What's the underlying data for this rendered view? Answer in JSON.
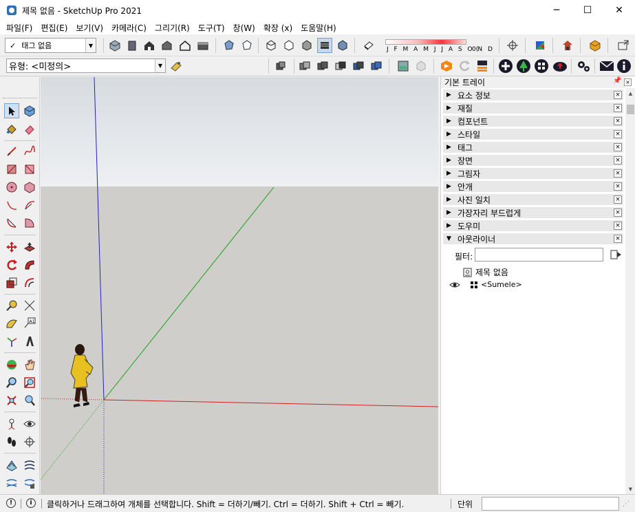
{
  "window": {
    "title": "제목 없음 - SketchUp Pro 2021",
    "minimize": "─",
    "maximize": "☐",
    "close": "✕"
  },
  "menu": [
    "파일(F)",
    "편집(E)",
    "보기(V)",
    "카메라(C)",
    "그리기(R)",
    "도구(T)",
    "창(W)",
    "확장 (x)",
    "도움말(H)"
  ],
  "toolbar": {
    "tag_check": "✓",
    "tag_value": "태그 없음",
    "type_value": "유형: <미정의>",
    "shadow_months": "J F M A M J J A S O N D",
    "shadow_right": "0("
  },
  "tray": {
    "title": "기본 트레이",
    "pin": "📌",
    "close": "×",
    "panels": [
      {
        "label": "요소 정보",
        "expanded": false
      },
      {
        "label": "재질",
        "expanded": false
      },
      {
        "label": "컴포넌트",
        "expanded": false
      },
      {
        "label": "스타일",
        "expanded": false
      },
      {
        "label": "태그",
        "expanded": false
      },
      {
        "label": "장면",
        "expanded": false
      },
      {
        "label": "그림자",
        "expanded": false
      },
      {
        "label": "안개",
        "expanded": false
      },
      {
        "label": "사진 일치",
        "expanded": false
      },
      {
        "label": "가장자리 부드럽게",
        "expanded": false
      },
      {
        "label": "도우미",
        "expanded": false
      },
      {
        "label": "아웃라이너",
        "expanded": true
      }
    ],
    "panel_close": "×",
    "arrow_collapsed": "▶",
    "arrow_expanded": "▼",
    "outliner": {
      "filter_label": "필터:",
      "filter_value": "",
      "root": "제목 없음",
      "child": "<Sumele>"
    }
  },
  "status": {
    "text": "클릭하거나 드래그하여 개체를 선택합니다. Shift = 더하기/빼기. Ctrl = 더하기. Shift + Ctrl = 빼기.",
    "units_label": "단위",
    "units_value": ""
  },
  "colors": {
    "sky": "#dfe3e8",
    "ground": "#cfcecb",
    "axis_red": "#d02020",
    "axis_green": "#1aa01a",
    "axis_blue": "#2020c8"
  }
}
